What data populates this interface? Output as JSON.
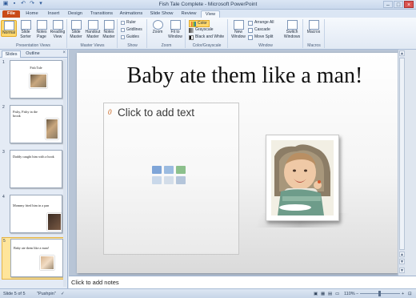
{
  "window": {
    "title": "Fish Tale Complete - Microsoft PowerPoint"
  },
  "tabs": [
    {
      "label": "File"
    },
    {
      "label": "Home"
    },
    {
      "label": "Insert"
    },
    {
      "label": "Design"
    },
    {
      "label": "Transitions"
    },
    {
      "label": "Animations"
    },
    {
      "label": "Slide Show"
    },
    {
      "label": "Review"
    },
    {
      "label": "View"
    }
  ],
  "ribbon": {
    "presentation_views": {
      "label": "Presentation Views",
      "normal": "Normal",
      "slide_sorter": "Slide Sorter",
      "notes_page": "Notes Page",
      "reading_view": "Reading View"
    },
    "master_views": {
      "label": "Master Views",
      "slide_master": "Slide Master",
      "handout_master": "Handout Master",
      "notes_master": "Notes Master"
    },
    "show": {
      "label": "Show",
      "ruler": "Ruler",
      "gridlines": "Gridlines",
      "guides": "Guides"
    },
    "zoom": {
      "label": "Zoom",
      "zoom": "Zoom",
      "fit_to_window": "Fit to Window"
    },
    "color_grayscale": {
      "label": "Color/Grayscale",
      "color": "Color",
      "grayscale": "Grayscale",
      "black_and_white": "Black and White"
    },
    "window": {
      "label": "Window",
      "new_window": "New Window",
      "arrange_all": "Arrange All",
      "cascade": "Cascade",
      "move_split": "Move Split",
      "switch_windows": "Switch Windows"
    },
    "macros": {
      "label": "Macros",
      "macros": "Macros"
    }
  },
  "left_pane": {
    "tab_slides": "Slides",
    "tab_outline": "Outline",
    "thumbnails": [
      {
        "num": "1",
        "title": "Fish Tale"
      },
      {
        "num": "2",
        "title": "Fishy, Fishy in the brook"
      },
      {
        "num": "3",
        "title": "Daddy caught him with a hook"
      },
      {
        "num": "4",
        "title": "Mommy fried him in a pan"
      },
      {
        "num": "5",
        "title": "Baby ate them like a man!"
      }
    ]
  },
  "slide": {
    "title": "Baby ate them like a man!",
    "placeholder_text": "Click to add text"
  },
  "notes": {
    "placeholder": "Click to add notes"
  },
  "status": {
    "slide_info": "Slide 5 of 5",
    "theme": "\"Pushpin\"",
    "zoom": "110%"
  }
}
